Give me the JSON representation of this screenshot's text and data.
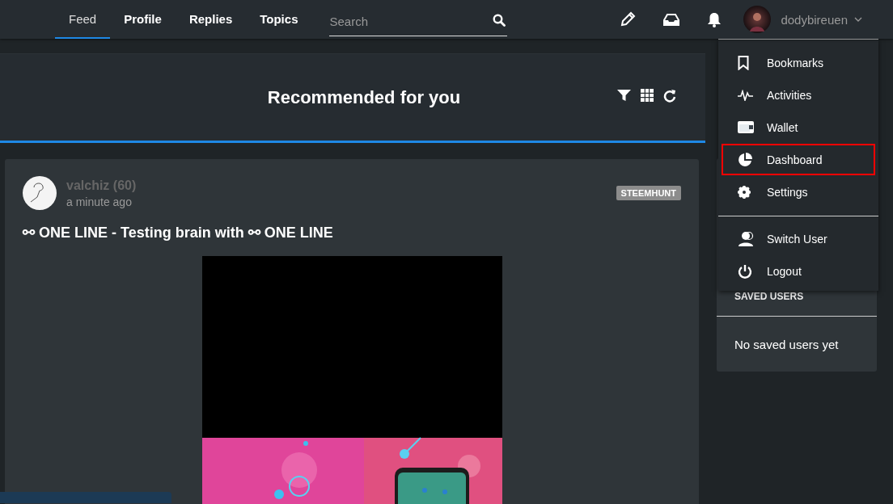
{
  "nav": {
    "tabs": [
      {
        "label": "Feed",
        "selected": true
      },
      {
        "label": "Profile",
        "selected": false
      },
      {
        "label": "Replies",
        "selected": false
      },
      {
        "label": "Topics",
        "selected": false
      }
    ],
    "search": {
      "placeholder": "Search"
    },
    "user": {
      "name": "dodybireuen"
    }
  },
  "feed": {
    "title": "Recommended for you",
    "post": {
      "author": "valchiz",
      "reputation": "(60)",
      "time": "a minute ago",
      "tag": "STEEMHUNT",
      "title": "⚯ ONE LINE - Testing brain with ⚯ ONE LINE"
    }
  },
  "sidebar": {
    "heading": "SAVED USERS",
    "empty_text": "No saved users yet"
  },
  "menu": {
    "sections": [
      [
        {
          "label": "Bookmarks",
          "highlighted": false
        },
        {
          "label": "Activities",
          "highlighted": false
        },
        {
          "label": "Wallet",
          "highlighted": false
        },
        {
          "label": "Dashboard",
          "highlighted": true
        },
        {
          "label": "Settings",
          "highlighted": false
        }
      ],
      [
        {
          "label": "Switch User",
          "highlighted": false
        },
        {
          "label": "Logout",
          "highlighted": false
        }
      ]
    ]
  }
}
